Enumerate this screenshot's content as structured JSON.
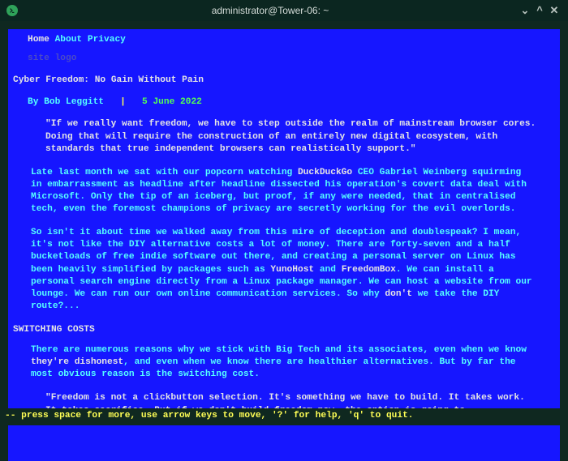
{
  "window": {
    "title": "administrator@Tower-06: ~",
    "icon": "terminal-icon"
  },
  "nav": {
    "home": "Home",
    "about": "About",
    "privacy": "Privacy"
  },
  "site_logo": "site logo",
  "article": {
    "title": "Cyber Freedom: No Gain Without Pain",
    "byline": {
      "by": "By Bob Leggitt",
      "sep": "|",
      "date": "5 June 2022"
    },
    "quote1": "\"If we really want freedom, we have to step outside the realm of mainstream browser cores. Doing that will require the construction of an entirely new digital ecosystem, with standards that true independent browsers can realistically support.\"",
    "p1a": "Late last month we sat with our popcorn watching ",
    "p1link": "DuckDuckGo",
    "p1b": " CEO Gabriel Weinberg squirming in embarrassment as headline after headline dissected his operation's covert data deal with Microsoft. Only the tip of an iceberg, but proof, if any were needed, that in centralised tech, even the foremost champions of privacy are secretly working for the evil overlords.",
    "p2a": "So isn't it about time we walked away from this mire of deception and doublespeak? I mean, it's not like the DIY alternative costs a lot of money. There are forty-seven and a half bucketloads of free indie software out there, and creating a personal server on Linux has been heavily simplified by packages such as ",
    "p2link1": "YunoHost",
    "p2mid": " and ",
    "p2link2": "FreedomBox",
    "p2b": ". We can install a personal search engine directly from a Linux package manager. We can host a website from our lounge. We can run our own online communication services. So why ",
    "p2bold": "don't",
    "p2c": " we take the DIY route?...",
    "heading1": "SWITCHING COSTS",
    "p3a": "There are numerous reasons why we stick with Big Tech and its associates, even when we know ",
    "p3link": "they're dishonest",
    "p3b": ", and even when we know there are healthier alternatives. But by far the most obvious reason is the switching cost.",
    "quote2": "\"Freedom is not a clickbutton selection. It's something we have to build. It takes work. It takes sacrifice. But if we don't build freedom now, the option is going to"
  },
  "status": "-- press space for more, use arrow keys to move, '?' for help, 'q' to quit."
}
